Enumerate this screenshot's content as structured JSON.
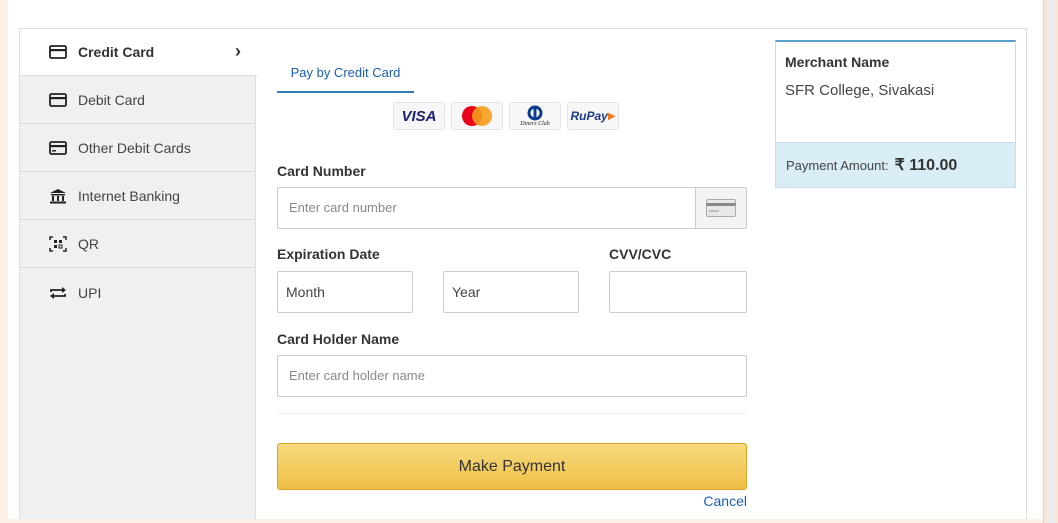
{
  "sidebar": {
    "items": [
      {
        "label": "Credit Card",
        "icon": "card-icon",
        "active": true
      },
      {
        "label": "Debit Card",
        "icon": "card-icon"
      },
      {
        "label": "Other Debit Cards",
        "icon": "card-icon"
      },
      {
        "label": "Internet Banking",
        "icon": "bank-icon"
      },
      {
        "label": "QR",
        "icon": "qr-icon"
      },
      {
        "label": "UPI",
        "icon": "transfer-icon"
      }
    ]
  },
  "main": {
    "tab_label": "Pay by Credit Card",
    "logos": {
      "visa": "VISA",
      "diners": "Diners Club",
      "rupay": "RuPay"
    },
    "card_number_label": "Card Number",
    "card_number_placeholder": "Enter card number",
    "expiration_label": "Expiration Date",
    "month_placeholder": "Month",
    "year_placeholder": "Year",
    "cvv_label": "CVV/CVC",
    "holder_label": "Card Holder Name",
    "holder_placeholder": "Enter card holder name",
    "pay_button": "Make Payment",
    "cancel_link": "Cancel"
  },
  "merchant": {
    "title": "Merchant Name",
    "name": "SFR College, Sivakasi",
    "amount_label": "Payment Amount:",
    "amount_value": "₹ 110.00"
  },
  "colors": {
    "accent": "#337ab7",
    "button": "#f0bf44",
    "amount_bg": "#d9edf7"
  }
}
